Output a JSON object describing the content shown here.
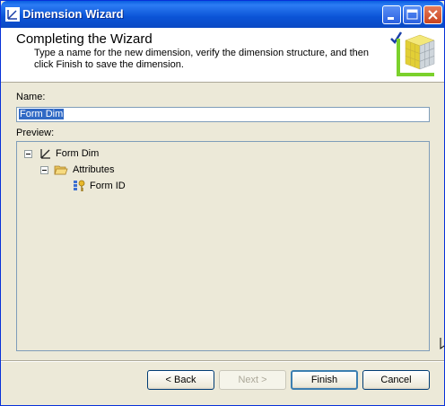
{
  "window": {
    "title": "Dimension Wizard"
  },
  "header": {
    "title": "Completing the Wizard",
    "description": "Type a name for the new dimension, verify the dimension structure, and then click Finish to save the dimension."
  },
  "name_field": {
    "label": "Name:",
    "value": "Form Dim"
  },
  "preview": {
    "label": "Preview:",
    "tree": {
      "root": "Form Dim",
      "folder": "Attributes",
      "attribute": "Form ID"
    }
  },
  "buttons": {
    "back": "< Back",
    "next": "Next >",
    "finish": "Finish",
    "cancel": "Cancel"
  },
  "colors": {
    "titlebar": "#0a5fe0",
    "dialog_bg": "#ece9d8",
    "selection": "#316ac5"
  }
}
